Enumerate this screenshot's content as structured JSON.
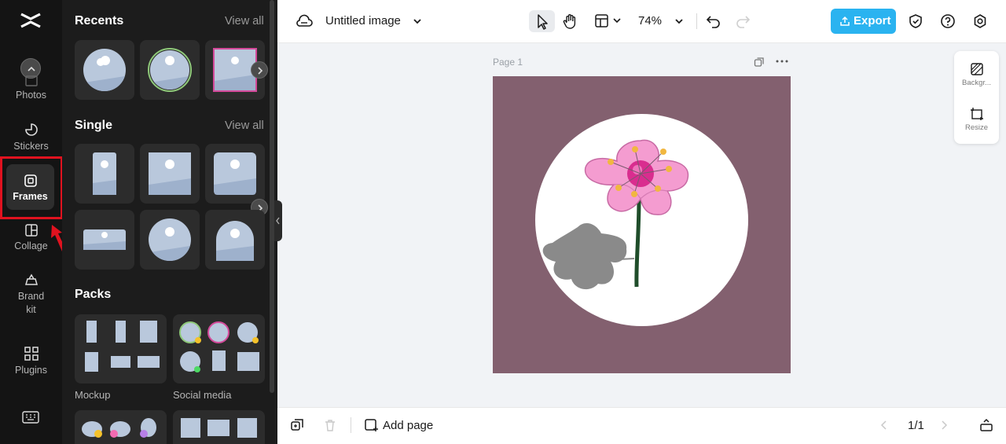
{
  "rail": {
    "items": [
      {
        "label": "Photos"
      },
      {
        "label": "Stickers"
      },
      {
        "label": "Frames"
      },
      {
        "label": "Collage"
      },
      {
        "label": "Brand kit"
      },
      {
        "label": "Plugins"
      }
    ]
  },
  "panel": {
    "recents": {
      "title": "Recents",
      "view_all": "View all"
    },
    "single": {
      "title": "Single",
      "view_all": "View all"
    },
    "packs": {
      "title": "Packs",
      "items": [
        {
          "label": "Mockup"
        },
        {
          "label": "Social media"
        }
      ]
    }
  },
  "topbar": {
    "title": "Untitled image",
    "zoom": "74%",
    "export_label": "Export"
  },
  "canvas": {
    "page_label": "Page 1",
    "page_color": "#83606f"
  },
  "sidepanel": {
    "background_label": "Backgr...",
    "resize_label": "Resize"
  },
  "bottombar": {
    "add_page_label": "Add page",
    "page_count": "1/1"
  },
  "colors": {
    "accent": "#2ab3f0",
    "highlight": "#e0121f",
    "rail_bg": "#141414",
    "panel_bg": "#1c1c1c"
  }
}
